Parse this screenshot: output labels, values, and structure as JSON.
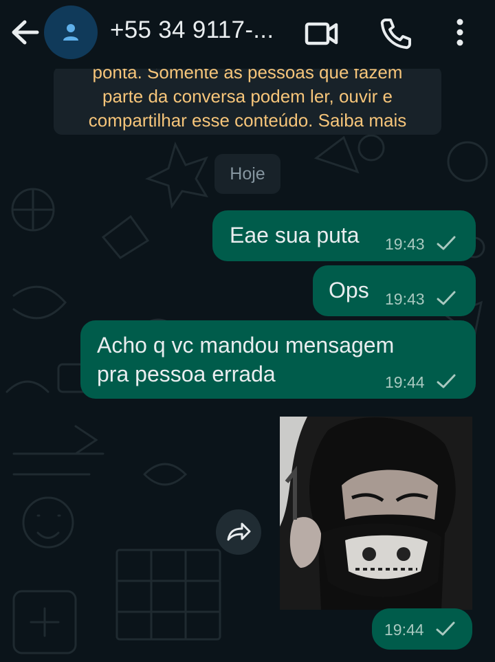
{
  "header": {
    "title": "+55 34 9117-...",
    "back_icon": "arrow-left-icon",
    "avatar_icon": "person-icon",
    "video_icon": "video-camera-icon",
    "call_icon": "phone-icon",
    "menu_icon": "more-vertical-icon"
  },
  "encryption_notice": {
    "line1": "ponta. Somente as pessoas que fazem",
    "line2": "parte da conversa podem ler, ouvir e",
    "line3": "compartilhar esse conteúdo. Saiba mais"
  },
  "date_divider": "Hoje",
  "messages": [
    {
      "text": "Eae sua puta",
      "time": "19:43",
      "status": "sent"
    },
    {
      "text": "Ops",
      "time": "19:43",
      "status": "sent"
    },
    {
      "line1": "Acho q vc mandou mensagem",
      "line2": "pra pessoa errada",
      "time": "19:44",
      "status": "sent"
    },
    {
      "type": "image",
      "time": "19:44",
      "status": "sent",
      "forward_icon": "forward-icon"
    }
  ],
  "colors": {
    "background": "#0b141a",
    "bubble_out": "#005c4b",
    "notice_bg": "#182229",
    "notice_text": "#f6c57a",
    "timestamp": "#a9c9c0"
  }
}
